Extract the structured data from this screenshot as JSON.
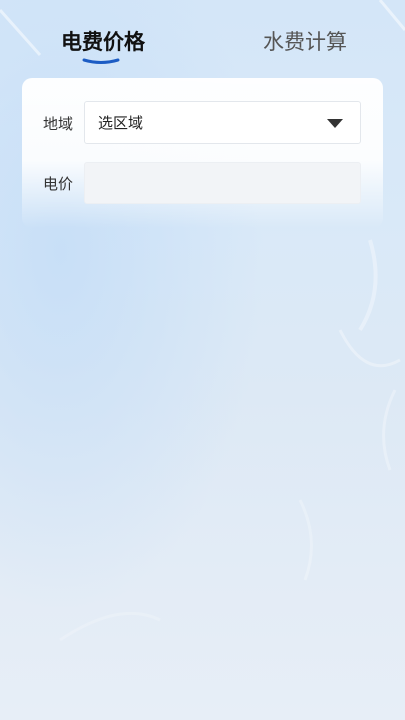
{
  "tabs": {
    "active_label": "电费价格",
    "inactive_label": "水费计算"
  },
  "form": {
    "region_label": "地域",
    "region_value": "选区域",
    "price_label": "电价",
    "price_value": ""
  },
  "colors": {
    "accent": "#1c5cc4",
    "background": "#d8e8f8"
  }
}
